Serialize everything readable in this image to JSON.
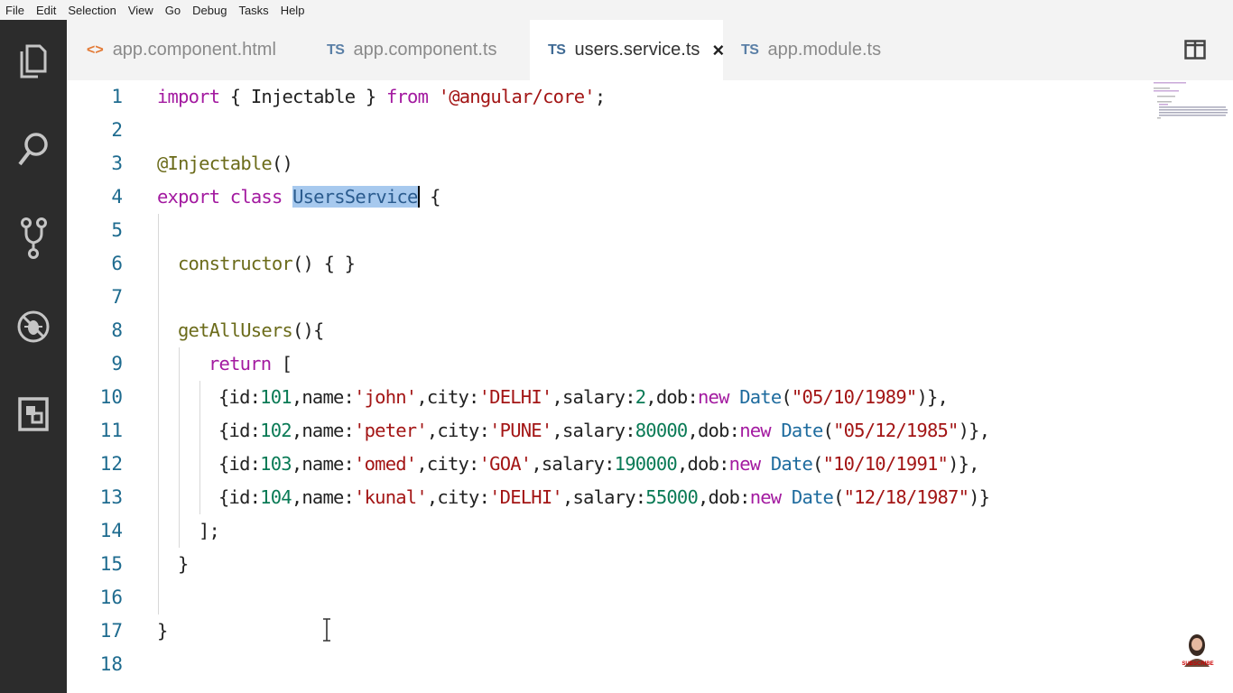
{
  "menu": [
    "File",
    "Edit",
    "Selection",
    "View",
    "Go",
    "Debug",
    "Tasks",
    "Help"
  ],
  "activity_bar": [
    {
      "icon": "files-icon"
    },
    {
      "icon": "search-icon"
    },
    {
      "icon": "source-control-icon"
    },
    {
      "icon": "debug-icon"
    },
    {
      "icon": "extensions-icon"
    }
  ],
  "tabs": [
    {
      "badge": "<>",
      "label": "app.component.html",
      "active": false
    },
    {
      "badge": "TS",
      "label": "app.component.ts",
      "active": false
    },
    {
      "badge": "TS",
      "label": "users.service.ts",
      "active": true,
      "close": "×"
    },
    {
      "badge": "TS",
      "label": "app.module.ts",
      "active": false
    }
  ],
  "line_numbers": [
    "1",
    "2",
    "3",
    "4",
    "5",
    "6",
    "7",
    "8",
    "9",
    "10",
    "11",
    "12",
    "13",
    "14",
    "15",
    "16",
    "17",
    "18"
  ],
  "code": {
    "l1": {
      "kw1": "import",
      "t1": " { Injectable } ",
      "kw2": "from",
      "str": " '@angular/core'",
      "t2": ";"
    },
    "l3": {
      "dec": "@Injectable",
      "t": "()"
    },
    "l4": {
      "kw1": "export",
      "kw2": " class ",
      "sel": "UsersService",
      "t": " {"
    },
    "l6": {
      "fn": "constructor",
      "t": "() { }"
    },
    "l8": {
      "fn": "getAllUsers",
      "t": "(){"
    },
    "l9": {
      "kw": "return",
      "t": " ["
    },
    "l10": {
      "a": "{id:",
      "n1": "101",
      "b": ",name:",
      "s1": "'john'",
      "c": ",city:",
      "s2": "'DELHI'",
      "d": ",salary:",
      "n2": "2",
      "e": ",dob:",
      "kw": "new",
      "f": " ",
      "typ": "Date",
      "g": "(",
      "s3": "\"05/10/1989\"",
      "h": ")},"
    },
    "l11": {
      "a": "{id:",
      "n1": "102",
      "b": ",name:",
      "s1": "'peter'",
      "c": ",city:",
      "s2": "'PUNE'",
      "d": ",salary:",
      "n2": "80000",
      "e": ",dob:",
      "kw": "new",
      "f": " ",
      "typ": "Date",
      "g": "(",
      "s3": "\"05/12/1985\"",
      "h": ")},"
    },
    "l12": {
      "a": "{id:",
      "n1": "103",
      "b": ",name:",
      "s1": "'omed'",
      "c": ",city:",
      "s2": "'GOA'",
      "d": ",salary:",
      "n2": "190000",
      "e": ",dob:",
      "kw": "new",
      "f": " ",
      "typ": "Date",
      "g": "(",
      "s3": "\"10/10/1991\"",
      "h": ")},"
    },
    "l13": {
      "a": "{id:",
      "n1": "104",
      "b": ",name:",
      "s1": "'kunal'",
      "c": ",city:",
      "s2": "'DELHI'",
      "d": ",salary:",
      "n2": "55000",
      "e": ",dob:",
      "kw": "new",
      "f": " ",
      "typ": "Date",
      "g": "(",
      "s3": "\"12/18/1987\"",
      "h": ")}"
    },
    "l14": {
      "t": "];"
    },
    "l15": {
      "t": "}"
    },
    "l17": {
      "t": "}"
    }
  },
  "overlay": {
    "subscribe": "SUBSCRIBE"
  }
}
